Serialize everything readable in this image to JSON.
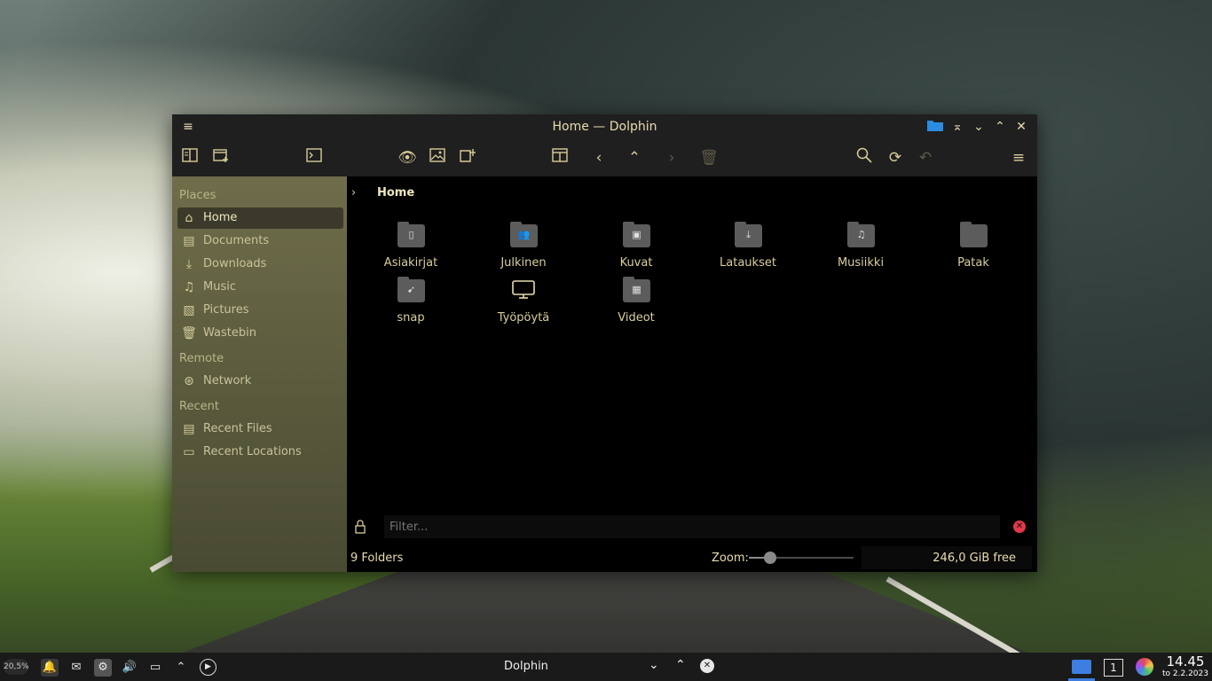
{
  "window": {
    "title": "Home — Dolphin"
  },
  "breadcrumb": {
    "current": "Home"
  },
  "sidebar": {
    "sections": [
      {
        "title": "Places",
        "items": [
          {
            "label": "Home",
            "icon": "home-icon",
            "active": true
          },
          {
            "label": "Documents",
            "icon": "document-icon"
          },
          {
            "label": "Downloads",
            "icon": "download-icon"
          },
          {
            "label": "Music",
            "icon": "music-icon"
          },
          {
            "label": "Pictures",
            "icon": "picture-icon"
          },
          {
            "label": "Wastebin",
            "icon": "trash-icon"
          }
        ]
      },
      {
        "title": "Remote",
        "items": [
          {
            "label": "Network",
            "icon": "network-icon"
          }
        ]
      },
      {
        "title": "Recent",
        "items": [
          {
            "label": "Recent Files",
            "icon": "recent-files-icon"
          },
          {
            "label": "Recent Locations",
            "icon": "recent-locations-icon"
          }
        ]
      }
    ]
  },
  "folders": [
    {
      "name": "Asiakirjat",
      "icon": "folder-documents-icon"
    },
    {
      "name": "Julkinen",
      "icon": "folder-public-icon"
    },
    {
      "name": "Kuvat",
      "icon": "folder-pictures-icon"
    },
    {
      "name": "Lataukset",
      "icon": "folder-downloads-icon"
    },
    {
      "name": "Musiikki",
      "icon": "folder-music-icon"
    },
    {
      "name": "Patak",
      "icon": "folder-icon"
    },
    {
      "name": "snap",
      "icon": "folder-snap-icon"
    },
    {
      "name": "Työpöytä",
      "icon": "desktop-icon"
    },
    {
      "name": "Videot",
      "icon": "folder-videos-icon"
    }
  ],
  "filter": {
    "placeholder": "Filter..."
  },
  "status": {
    "folder_count": "9 Folders",
    "zoom_label": "Zoom:",
    "zoom_level": 0.2,
    "free_space": "246,0 GiB free"
  },
  "taskbar": {
    "cpu": "20,5%",
    "task_label": "Dolphin",
    "desktop_number": "1",
    "time": "14.45",
    "date": "to 2.2.2023"
  },
  "colors": {
    "accent": "#e8dcb0",
    "close_red": "#e0384a",
    "sidebar": "#74724c",
    "active_task": "#3d7ee0"
  }
}
